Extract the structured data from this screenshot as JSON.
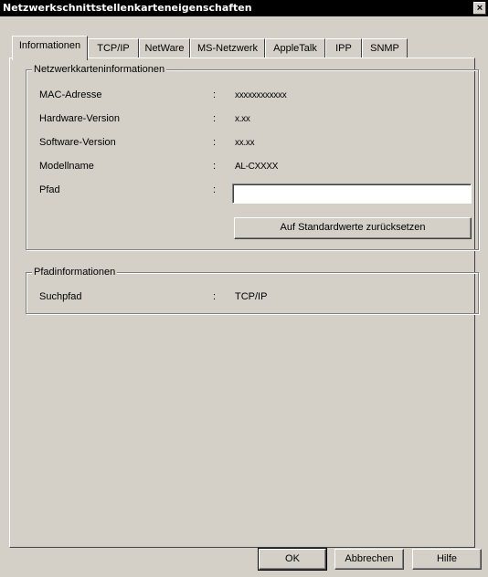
{
  "window": {
    "title": "Netzwerkschnittstellenkarteneigenschaften",
    "close_glyph": "×"
  },
  "tabs": [
    {
      "label": "Informationen"
    },
    {
      "label": "TCP/IP"
    },
    {
      "label": "NetWare"
    },
    {
      "label": "MS-Netzwerk"
    },
    {
      "label": "AppleTalk"
    },
    {
      "label": "IPP"
    },
    {
      "label": "SNMP"
    }
  ],
  "netcard_group": {
    "title": "Netzwerkkarteninformationen",
    "rows": [
      {
        "label": "MAC-Adresse",
        "value": "xxxxxxxxxxxx"
      },
      {
        "label": "Hardware-Version",
        "value": "x.xx"
      },
      {
        "label": "Software-Version",
        "value": "xx.xx"
      },
      {
        "label": "Modellname",
        "value": "AL-CXXXX"
      }
    ],
    "path_label": "Pfad",
    "path_value": "",
    "reset_button": "Auf Standardwerte zurücksetzen"
  },
  "path_group": {
    "title": "Pfadinformationen",
    "search_label": "Suchpfad",
    "search_value": "TCP/IP"
  },
  "separator": ":",
  "buttons": {
    "ok": "OK",
    "cancel": "Abbrechen",
    "help": "Hilfe"
  }
}
